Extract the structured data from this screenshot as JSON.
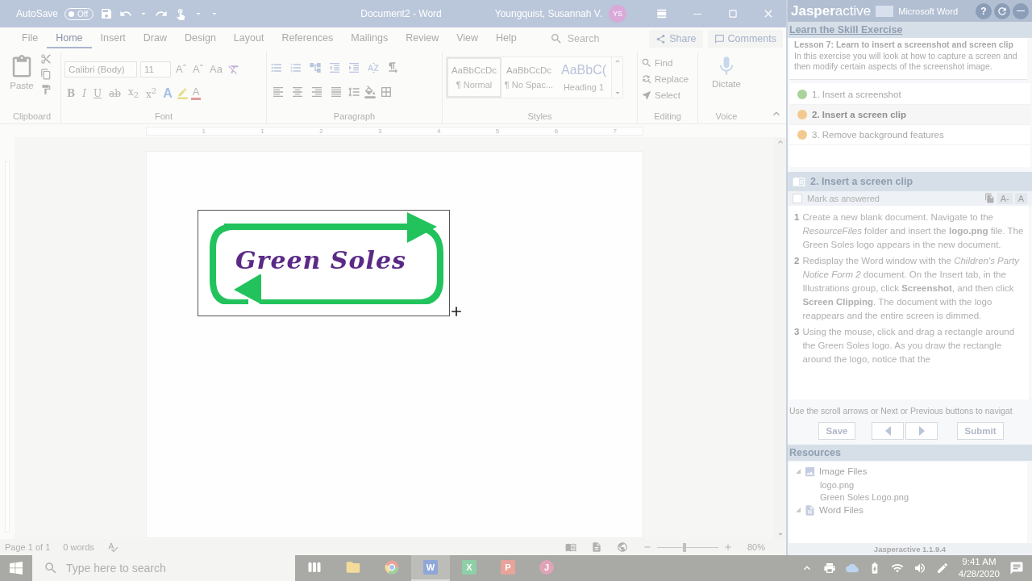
{
  "title_bar": {
    "autosave_label": "AutoSave",
    "autosave_state": "Off",
    "autosave_on": false,
    "document_title": "Document2  -  Word",
    "user_name": "Youngquist, Susannah V.",
    "user_initials": "YS"
  },
  "ribbon_tabs": [
    {
      "label": "File",
      "selected": false
    },
    {
      "label": "Home",
      "selected": true
    },
    {
      "label": "Insert",
      "selected": false
    },
    {
      "label": "Draw",
      "selected": false
    },
    {
      "label": "Design",
      "selected": false
    },
    {
      "label": "Layout",
      "selected": false
    },
    {
      "label": "References",
      "selected": false
    },
    {
      "label": "Mailings",
      "selected": false
    },
    {
      "label": "Review",
      "selected": false
    },
    {
      "label": "View",
      "selected": false
    },
    {
      "label": "Help",
      "selected": false
    }
  ],
  "tell_me": {
    "placeholder": "Search"
  },
  "share_button": "Share",
  "comments_button": "Comments",
  "clipboard": {
    "paste": "Paste",
    "group": "Clipboard"
  },
  "font": {
    "name": "Calibri (Body)",
    "size": "11",
    "grow": "Aˆ",
    "shrink": "Aˇ",
    "change_case": "Aa",
    "format_buttons": [
      {
        "label": "B",
        "kind": "bold"
      },
      {
        "label": "I",
        "kind": "italic"
      },
      {
        "label": "U",
        "kind": "underline"
      },
      {
        "label": "ab",
        "kind": "strike"
      },
      {
        "label": "x$_{2}$",
        "kind": "script"
      },
      {
        "label": "x$^{2}$",
        "kind": "script"
      }
    ],
    "effects": "A",
    "font_color": "A",
    "group": "Font"
  },
  "paragraph": {
    "group": "Paragraph"
  },
  "styles": {
    "group": "Styles",
    "items": [
      {
        "preview": "AaBbCcDc",
        "name": "¶ Normal",
        "kind": "body",
        "selected": true
      },
      {
        "preview": "AaBbCcDc",
        "name": "¶ No Spac...",
        "kind": "body",
        "selected": false
      },
      {
        "preview": "AaBbC(",
        "name": "Heading 1",
        "kind": "heading",
        "selected": false
      }
    ]
  },
  "editing": {
    "group": "Editing",
    "items": [
      {
        "label": "Find",
        "kind": "find"
      },
      {
        "label": "Replace",
        "kind": "replace"
      },
      {
        "label": "Select",
        "kind": "select"
      }
    ]
  },
  "voice": {
    "label": "Dictate",
    "group": "Voice"
  },
  "ruler": {
    "numbers": [
      "1",
      "1",
      "2",
      "3",
      "4",
      "5",
      "6",
      "7"
    ]
  },
  "document": {
    "logo_text": "Green Soles"
  },
  "status_bar": {
    "page": "Page 1 of 1",
    "words": "0 words",
    "zoom": "80%",
    "zoom_slider": {
      "level": 0.45
    }
  },
  "jasper": {
    "brand": "**Jasper**active",
    "app_name": "Microsoft Word",
    "help": "?",
    "section_title": "Learn the Skill Exercise",
    "lesson_title": "Lesson 7: Learn to insert a screenshot and screen clip",
    "lesson_description": "In this exercise you will look at how to capture a screen and then modify certain aspects of the screenshot image.",
    "tasks": [
      {
        "label": "1. Insert a screenshot",
        "color": "#a9d39a",
        "selected": false
      },
      {
        "label": "2. Insert a screen clip",
        "color": "#f3c98f",
        "selected": true
      },
      {
        "label": "3. Remove background features",
        "color": "#f3c98f",
        "selected": false
      }
    ],
    "task_title": "2. Insert a screen clip",
    "mark_answered": {
      "label": "Mark as answered",
      "checked": false
    },
    "font_smaller": "A-",
    "font_larger": "A",
    "steps": [
      {
        "number": "1",
        "text": "Create a new blank document. Navigate to the *ResourceFiles* folder and insert the **logo.png** file. The Green Soles logo appears in the new document."
      },
      {
        "number": "2",
        "text": "Redisplay the Word window with the *Children's Party Notice Form 2* document. On the Insert tab, in the Illustrations group, click **Screenshot**, and then click **Screen Clipping**. The document with the logo reappears and the entire screen is dimmed."
      },
      {
        "number": "3",
        "text": "Using the mouse, click and drag a rectangle around the Green Soles logo. As you draw the rectangle around the logo, notice that the"
      }
    ],
    "hint": "Use the scroll arrows or Next or Previous buttons to navigat",
    "save_button": "Save",
    "submit_button": "Submit",
    "resources_title": "Resources",
    "resources": [
      {
        "label": "Image Files",
        "kind": "image",
        "expanded": true,
        "children": [
          {
            "label": "logo.png"
          },
          {
            "label": "Green Soles Logo.png"
          }
        ]
      },
      {
        "label": "Word Files",
        "kind": "word",
        "expanded": true
      }
    ],
    "version": "Jasperactive 1.1.9.4"
  },
  "taskbar": {
    "search_placeholder": "Type here to search",
    "apps": [
      {
        "kind": "taskview",
        "selected": false
      },
      {
        "kind": "explorer",
        "selected": false
      },
      {
        "kind": "chrome",
        "selected": false
      },
      {
        "kind": "office",
        "letter": "W",
        "color": "#8fa6d8",
        "selected": true
      },
      {
        "kind": "office",
        "letter": "X",
        "color": "#8fcfa6",
        "selected": false
      },
      {
        "kind": "office",
        "letter": "P",
        "color": "#e8a39a",
        "selected": false
      },
      {
        "kind": "round",
        "letter": "J",
        "color": "#e0a3b8",
        "selected": false
      }
    ],
    "time": "9:41 AM",
    "date": "4/28/2020"
  }
}
